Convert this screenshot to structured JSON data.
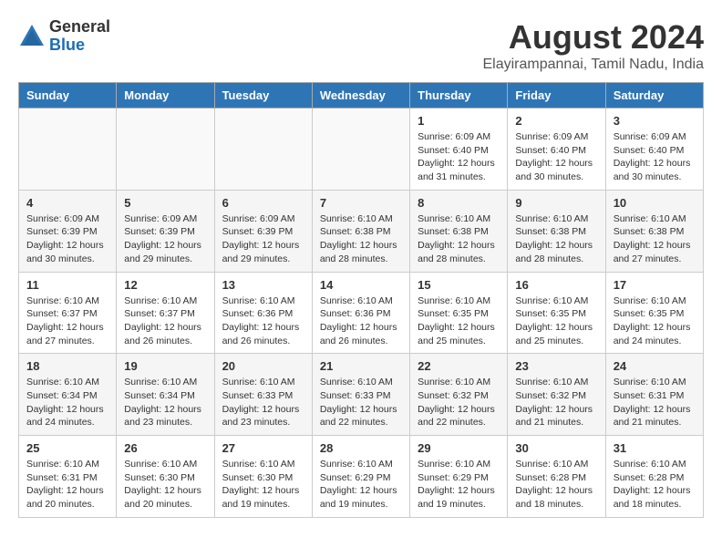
{
  "logo": {
    "general": "General",
    "blue": "Blue"
  },
  "title": "August 2024",
  "subtitle": "Elayirampannai, Tamil Nadu, India",
  "days_of_week": [
    "Sunday",
    "Monday",
    "Tuesday",
    "Wednesday",
    "Thursday",
    "Friday",
    "Saturday"
  ],
  "weeks": [
    [
      {
        "day": "",
        "info": ""
      },
      {
        "day": "",
        "info": ""
      },
      {
        "day": "",
        "info": ""
      },
      {
        "day": "",
        "info": ""
      },
      {
        "day": "1",
        "info": "Sunrise: 6:09 AM\nSunset: 6:40 PM\nDaylight: 12 hours\nand 31 minutes."
      },
      {
        "day": "2",
        "info": "Sunrise: 6:09 AM\nSunset: 6:40 PM\nDaylight: 12 hours\nand 30 minutes."
      },
      {
        "day": "3",
        "info": "Sunrise: 6:09 AM\nSunset: 6:40 PM\nDaylight: 12 hours\nand 30 minutes."
      }
    ],
    [
      {
        "day": "4",
        "info": "Sunrise: 6:09 AM\nSunset: 6:39 PM\nDaylight: 12 hours\nand 30 minutes."
      },
      {
        "day": "5",
        "info": "Sunrise: 6:09 AM\nSunset: 6:39 PM\nDaylight: 12 hours\nand 29 minutes."
      },
      {
        "day": "6",
        "info": "Sunrise: 6:09 AM\nSunset: 6:39 PM\nDaylight: 12 hours\nand 29 minutes."
      },
      {
        "day": "7",
        "info": "Sunrise: 6:10 AM\nSunset: 6:38 PM\nDaylight: 12 hours\nand 28 minutes."
      },
      {
        "day": "8",
        "info": "Sunrise: 6:10 AM\nSunset: 6:38 PM\nDaylight: 12 hours\nand 28 minutes."
      },
      {
        "day": "9",
        "info": "Sunrise: 6:10 AM\nSunset: 6:38 PM\nDaylight: 12 hours\nand 28 minutes."
      },
      {
        "day": "10",
        "info": "Sunrise: 6:10 AM\nSunset: 6:38 PM\nDaylight: 12 hours\nand 27 minutes."
      }
    ],
    [
      {
        "day": "11",
        "info": "Sunrise: 6:10 AM\nSunset: 6:37 PM\nDaylight: 12 hours\nand 27 minutes."
      },
      {
        "day": "12",
        "info": "Sunrise: 6:10 AM\nSunset: 6:37 PM\nDaylight: 12 hours\nand 26 minutes."
      },
      {
        "day": "13",
        "info": "Sunrise: 6:10 AM\nSunset: 6:36 PM\nDaylight: 12 hours\nand 26 minutes."
      },
      {
        "day": "14",
        "info": "Sunrise: 6:10 AM\nSunset: 6:36 PM\nDaylight: 12 hours\nand 26 minutes."
      },
      {
        "day": "15",
        "info": "Sunrise: 6:10 AM\nSunset: 6:35 PM\nDaylight: 12 hours\nand 25 minutes."
      },
      {
        "day": "16",
        "info": "Sunrise: 6:10 AM\nSunset: 6:35 PM\nDaylight: 12 hours\nand 25 minutes."
      },
      {
        "day": "17",
        "info": "Sunrise: 6:10 AM\nSunset: 6:35 PM\nDaylight: 12 hours\nand 24 minutes."
      }
    ],
    [
      {
        "day": "18",
        "info": "Sunrise: 6:10 AM\nSunset: 6:34 PM\nDaylight: 12 hours\nand 24 minutes."
      },
      {
        "day": "19",
        "info": "Sunrise: 6:10 AM\nSunset: 6:34 PM\nDaylight: 12 hours\nand 23 minutes."
      },
      {
        "day": "20",
        "info": "Sunrise: 6:10 AM\nSunset: 6:33 PM\nDaylight: 12 hours\nand 23 minutes."
      },
      {
        "day": "21",
        "info": "Sunrise: 6:10 AM\nSunset: 6:33 PM\nDaylight: 12 hours\nand 22 minutes."
      },
      {
        "day": "22",
        "info": "Sunrise: 6:10 AM\nSunset: 6:32 PM\nDaylight: 12 hours\nand 22 minutes."
      },
      {
        "day": "23",
        "info": "Sunrise: 6:10 AM\nSunset: 6:32 PM\nDaylight: 12 hours\nand 21 minutes."
      },
      {
        "day": "24",
        "info": "Sunrise: 6:10 AM\nSunset: 6:31 PM\nDaylight: 12 hours\nand 21 minutes."
      }
    ],
    [
      {
        "day": "25",
        "info": "Sunrise: 6:10 AM\nSunset: 6:31 PM\nDaylight: 12 hours\nand 20 minutes."
      },
      {
        "day": "26",
        "info": "Sunrise: 6:10 AM\nSunset: 6:30 PM\nDaylight: 12 hours\nand 20 minutes."
      },
      {
        "day": "27",
        "info": "Sunrise: 6:10 AM\nSunset: 6:30 PM\nDaylight: 12 hours\nand 19 minutes."
      },
      {
        "day": "28",
        "info": "Sunrise: 6:10 AM\nSunset: 6:29 PM\nDaylight: 12 hours\nand 19 minutes."
      },
      {
        "day": "29",
        "info": "Sunrise: 6:10 AM\nSunset: 6:29 PM\nDaylight: 12 hours\nand 19 minutes."
      },
      {
        "day": "30",
        "info": "Sunrise: 6:10 AM\nSunset: 6:28 PM\nDaylight: 12 hours\nand 18 minutes."
      },
      {
        "day": "31",
        "info": "Sunrise: 6:10 AM\nSunset: 6:28 PM\nDaylight: 12 hours\nand 18 minutes."
      }
    ]
  ]
}
